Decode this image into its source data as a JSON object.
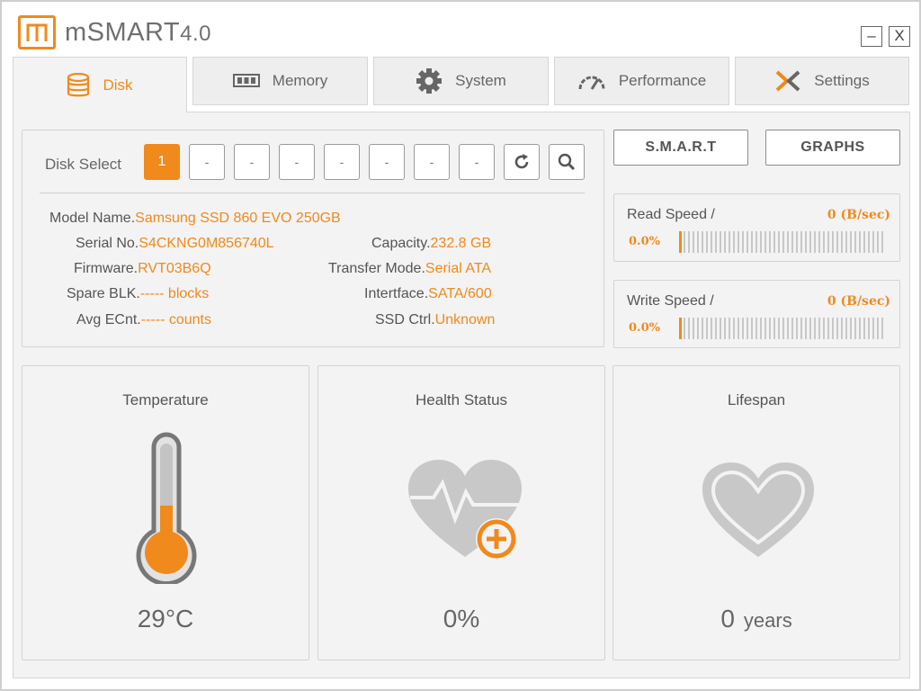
{
  "app": {
    "logo": "m",
    "name": "mSMART",
    "version": "4.0"
  },
  "window": {
    "minimize_icon": "–",
    "close_icon": "X"
  },
  "tabs": [
    {
      "label": "Disk",
      "icon": "database-icon"
    },
    {
      "label": "Memory",
      "icon": "memory-icon"
    },
    {
      "label": "System",
      "icon": "gear-icon"
    },
    {
      "label": "Performance",
      "icon": "gauge-icon"
    },
    {
      "label": "Settings",
      "icon": "tools-icon"
    }
  ],
  "disk_select": {
    "label": "Disk Select",
    "buttons": [
      "1",
      "-",
      "-",
      "-",
      "-",
      "-",
      "-",
      "-"
    ],
    "refresh_icon": "refresh-icon",
    "search_icon": "search-icon"
  },
  "disk_info": {
    "model": {
      "key": "Model Name.",
      "value": "Samsung SSD 860 EVO 250GB"
    },
    "serial": {
      "key": "Serial No.",
      "value": "S4CKNG0M856740L"
    },
    "firmware": {
      "key": "Firmware.",
      "value": "RVT03B6Q"
    },
    "spare": {
      "key": "Spare BLK.",
      "value": "----- blocks"
    },
    "ecnt": {
      "key": "Avg ECnt.",
      "value": "----- counts"
    },
    "capacity": {
      "key": "Capacity.",
      "value": "232.8 GB"
    },
    "transfer": {
      "key": "Transfer Mode.",
      "value": "Serial ATA"
    },
    "interface": {
      "key": "Intertface.",
      "value": "SATA/600"
    },
    "ctrl": {
      "key": "SSD Ctrl.",
      "value": "Unknown"
    }
  },
  "actions": {
    "smart": "S.M.A.R.T",
    "graphs": "GRAPHS"
  },
  "read_speed": {
    "label": "Read Speed /",
    "value": "0 (B/sec)",
    "percent": "0.0%",
    "level": 0
  },
  "write_speed": {
    "label": "Write Speed /",
    "value": "0 (B/sec)",
    "percent": "0.0%",
    "level": 0
  },
  "temperature": {
    "title": "Temperature",
    "value": "29°C",
    "icon": "thermometer-icon",
    "level": 0.29
  },
  "health": {
    "title": "Health Status",
    "value": "0%",
    "icon": "heart-pulse-icon"
  },
  "lifespan": {
    "title": "Lifespan",
    "value": "0",
    "unit": "years",
    "icon": "heart-icon"
  },
  "colors": {
    "accent": "#f08a1c",
    "panel": "#f3f3f3",
    "icon_gray": "#c8c8c8"
  }
}
